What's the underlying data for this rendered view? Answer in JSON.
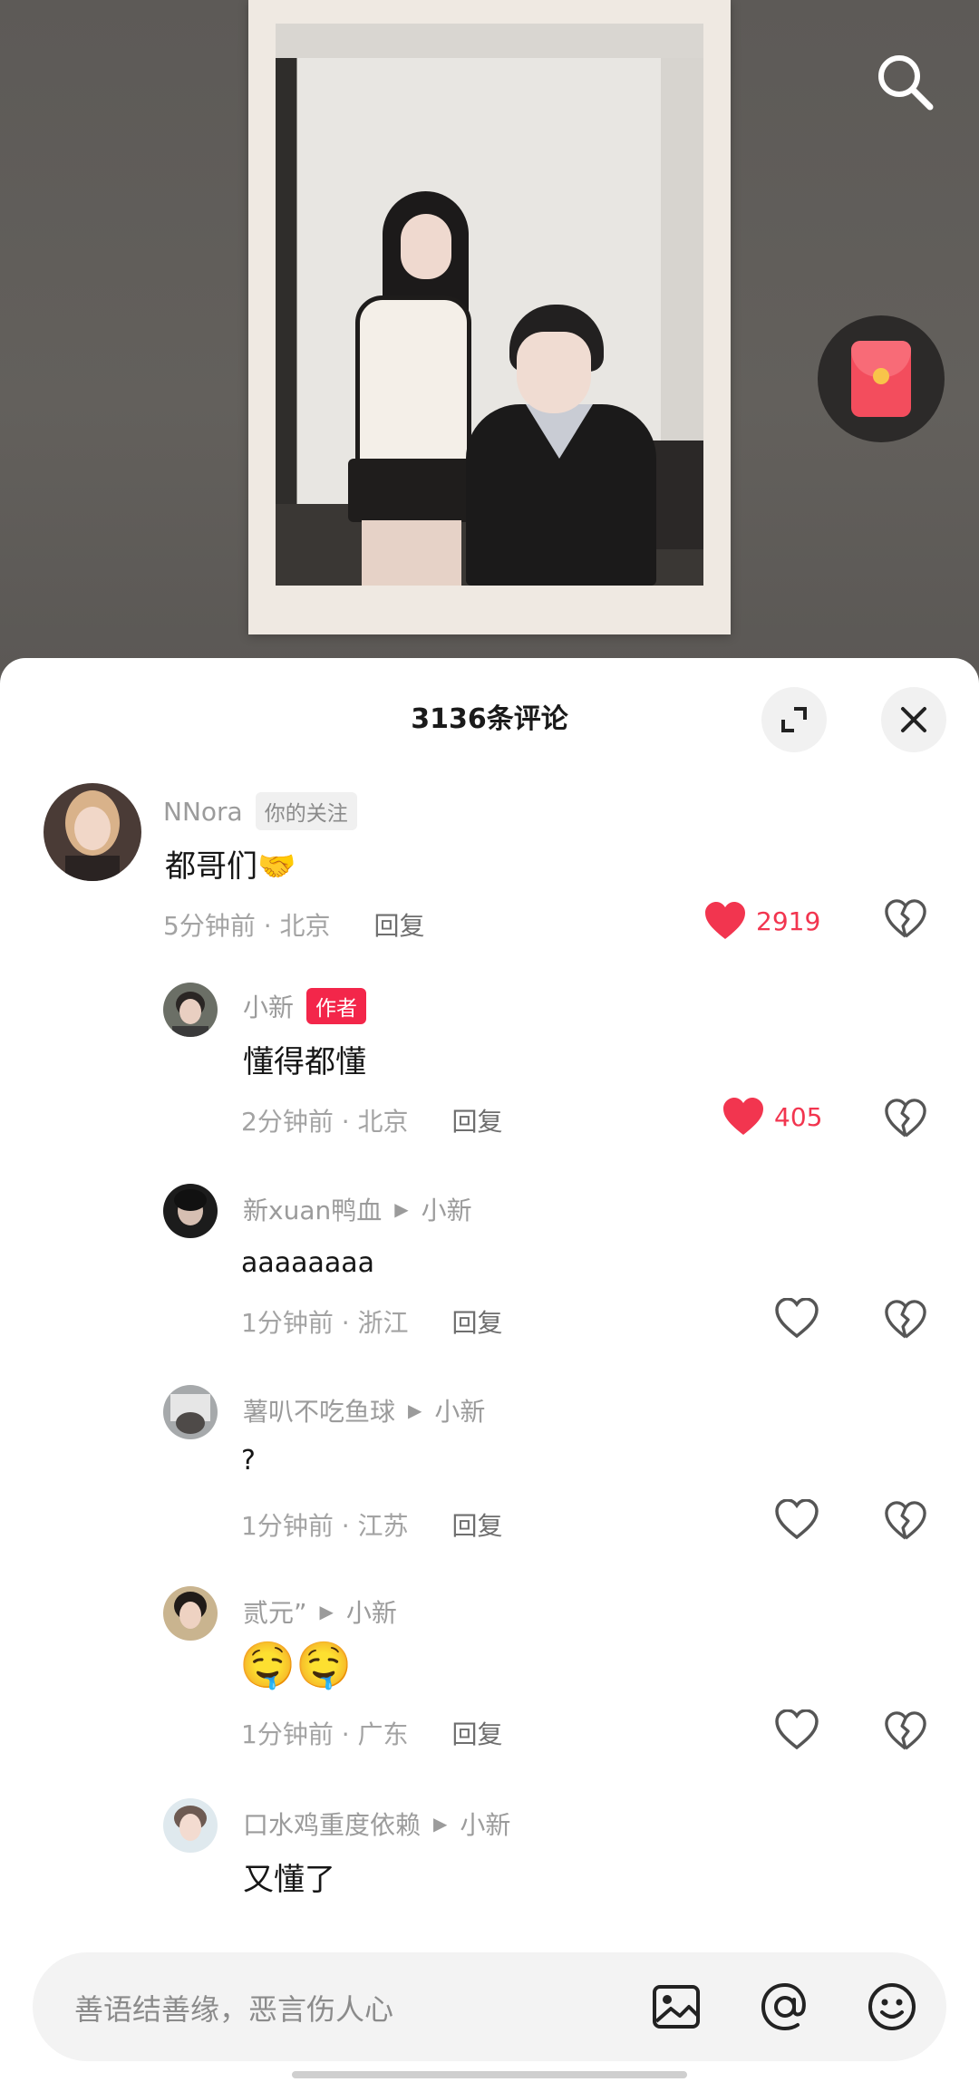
{
  "header": {
    "comment_count_title": "3136条评论"
  },
  "colors": {
    "like_red": "#f2354f",
    "author_tag": "#f3264a",
    "sheet_bg": "#ffffff"
  },
  "icons": {
    "search": "search-icon",
    "red_packet": "red-packet-icon",
    "expand": "expand-icon",
    "close": "close-icon",
    "heart": "heart-icon",
    "heart_broken": "broken-heart-icon",
    "image": "image-icon",
    "at": "at-icon",
    "emoji": "emoji-icon"
  },
  "comments": [
    {
      "username": "NNora",
      "tag": "你的关注",
      "text": "都哥们🤝",
      "time": "5分钟前 · 北京",
      "reply": "回复",
      "likes": "2919",
      "liked": true
    },
    {
      "username": "小新",
      "tag": "作者",
      "text": "懂得都懂",
      "time": "2分钟前 · 北京",
      "reply": "回复",
      "likes": "405",
      "liked": true
    },
    {
      "username": "新xuan鸭血",
      "reply_to": "小新",
      "text": "aaaaaaaa",
      "time": "1分钟前 · 浙江",
      "reply": "回复",
      "liked": false
    },
    {
      "username": "薯叭不吃鱼球",
      "reply_to": "小新",
      "text": "?",
      "time": "1分钟前 · 江苏",
      "reply": "回复",
      "liked": false
    },
    {
      "username": "贰元”",
      "reply_to": "小新",
      "text": "🤤🤤",
      "time": "1分钟前 · 广东",
      "reply": "回复",
      "liked": false
    },
    {
      "username": "口水鸡重度依赖",
      "reply_to": "小新",
      "text": "又懂了"
    }
  ],
  "input": {
    "placeholder": "善语结善缘，恶言伤人心"
  }
}
